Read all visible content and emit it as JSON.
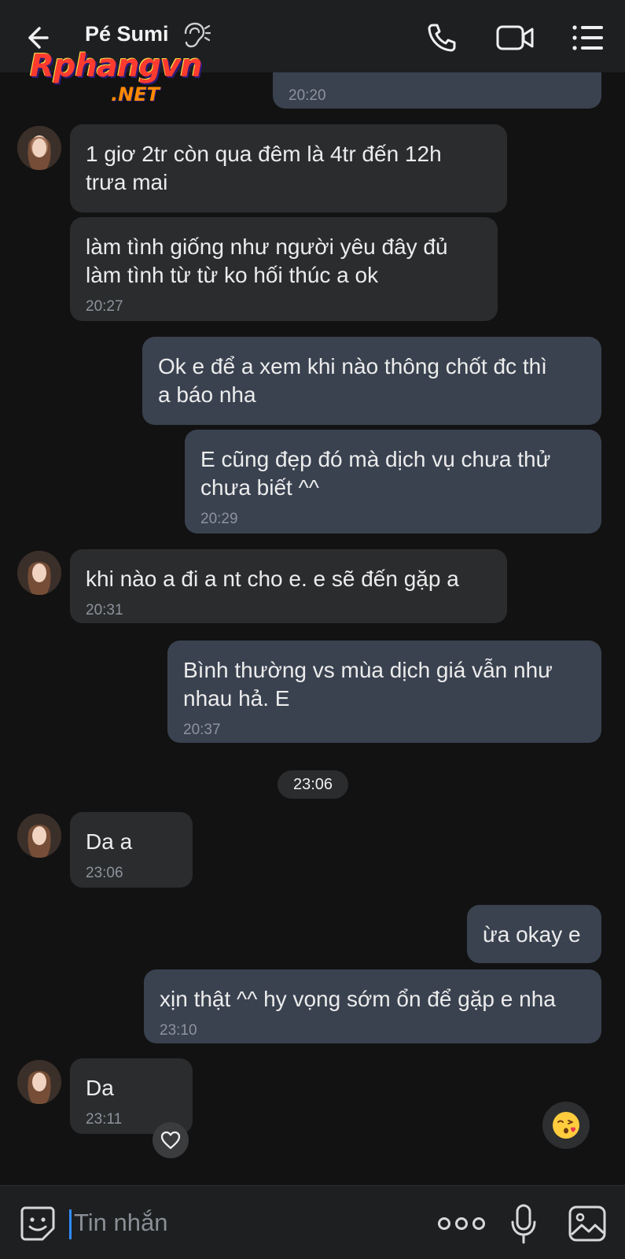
{
  "header": {
    "contact_name": "Pé Sumi",
    "icons": [
      "back-arrow-icon",
      "ear-icon",
      "phone-icon",
      "video-call-icon",
      "menu-icon"
    ]
  },
  "watermark": {
    "main": "Rphangvn",
    "sub": ".NET"
  },
  "messages": [
    {
      "dir": "out",
      "text": "...",
      "time": "20:20"
    },
    {
      "dir": "in",
      "text": "1 giơ 2tr còn qua đêm là 4tr   đến 12h\ntrưa mai",
      "time": ""
    },
    {
      "dir": "in",
      "text": "làm tình giống như người yêu đây đủ\nlàm tình từ từ ko hối thúc a ok",
      "time": "20:27"
    },
    {
      "dir": "out",
      "text": "Ok e để a xem khi nào thông chốt đc thì\na báo nha",
      "time": ""
    },
    {
      "dir": "out",
      "text": "E cũng đẹp đó mà dịch vụ chưa thử\nchưa biết ^^",
      "time": "20:29"
    },
    {
      "dir": "in",
      "text": "khi nào a đi a nt cho e. e sẽ đến gặp a",
      "time": "20:31"
    },
    {
      "dir": "out",
      "text": "Bình thường vs mùa dịch giá vẫn như\nnhau hả. E",
      "time": "20:37"
    },
    {
      "dir": "in",
      "text": "Da a",
      "time": "23:06"
    },
    {
      "dir": "out",
      "text": "ừa okay e",
      "time": ""
    },
    {
      "dir": "out",
      "text": "xịn thật ^^ hy vọng sớm ổn để gặp e nha",
      "time": "23:10"
    },
    {
      "dir": "in",
      "text": "Da",
      "time": "23:11"
    }
  ],
  "date_separator": "23:06",
  "bottom_bar": {
    "placeholder": "Tin nhắn",
    "icons": [
      "sticker-icon",
      "more-icon",
      "mic-icon",
      "image-icon"
    ]
  },
  "colors": {
    "background": "#121212",
    "bubble_in": "#2b2c2e",
    "bubble_out": "#3a4250",
    "accent": "#2f8bff"
  }
}
